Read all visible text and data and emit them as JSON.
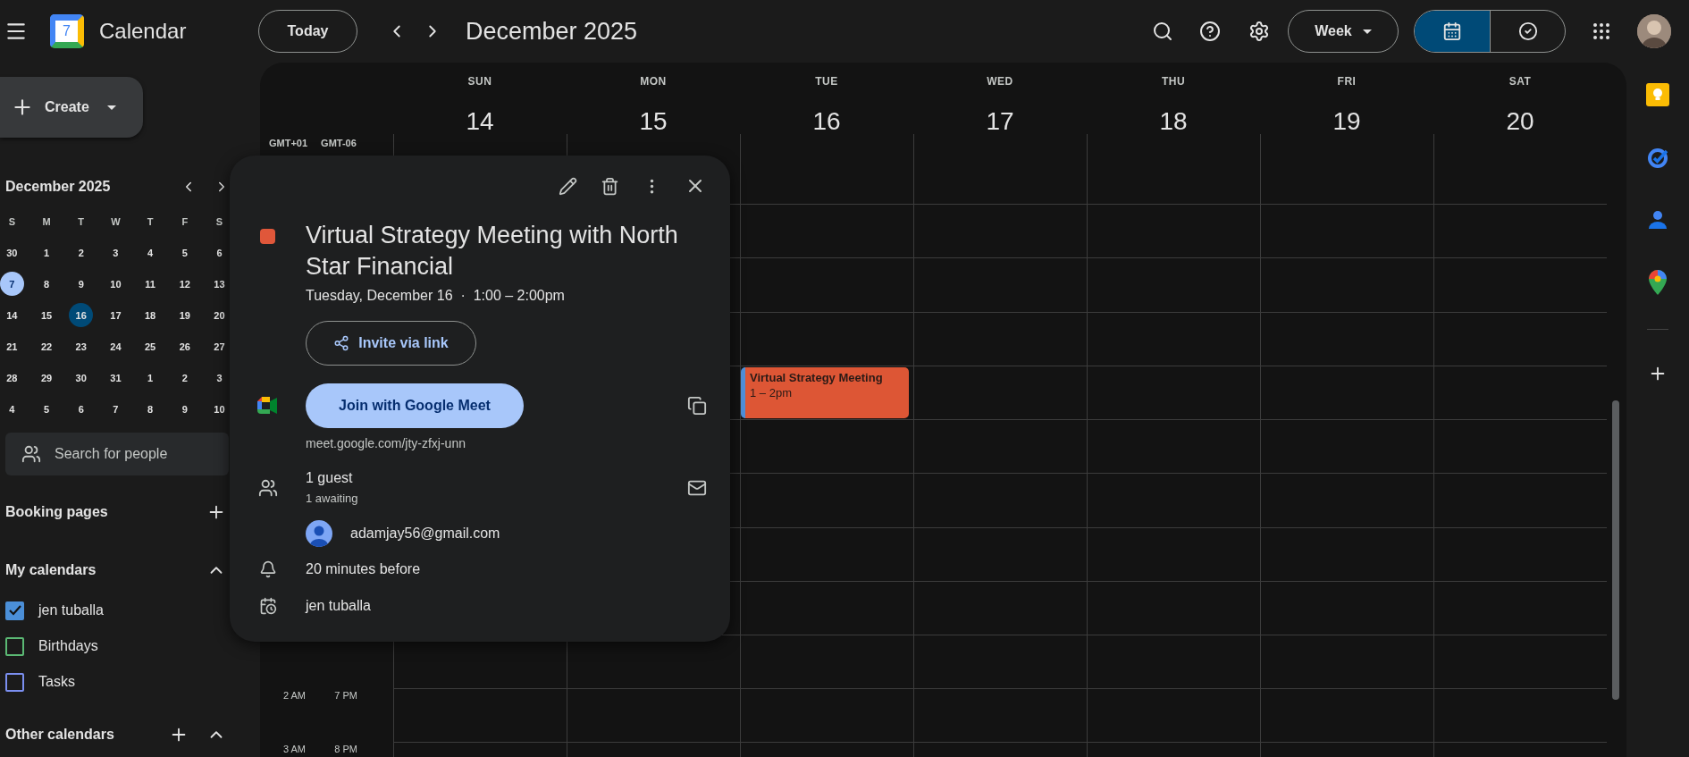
{
  "header": {
    "app_title": "Calendar",
    "logo_day": "7",
    "today_button": "Today",
    "period": "December 2025",
    "view_button": "Week",
    "mode_toggle": [
      {
        "kind": "calendar",
        "selected": true
      },
      {
        "kind": "tasks",
        "selected": false
      }
    ]
  },
  "sidebar": {
    "create_button": "Create",
    "mini_calendar": {
      "title": "December 2025",
      "weekdays": [
        "S",
        "M",
        "T",
        "W",
        "T",
        "F",
        "S"
      ],
      "weeks": [
        [
          {
            "day": "30",
            "today": false,
            "selected": false
          },
          {
            "day": "1",
            "today": false,
            "selected": false
          },
          {
            "day": "2",
            "today": false,
            "selected": false
          },
          {
            "day": "3",
            "today": false,
            "selected": false
          },
          {
            "day": "4",
            "today": false,
            "selected": false
          },
          {
            "day": "5",
            "today": false,
            "selected": false
          },
          {
            "day": "6",
            "today": false,
            "selected": false
          }
        ],
        [
          {
            "day": "7",
            "today": true,
            "selected": false
          },
          {
            "day": "8",
            "today": false,
            "selected": false
          },
          {
            "day": "9",
            "today": false,
            "selected": false
          },
          {
            "day": "10",
            "today": false,
            "selected": false
          },
          {
            "day": "11",
            "today": false,
            "selected": false
          },
          {
            "day": "12",
            "today": false,
            "selected": false
          },
          {
            "day": "13",
            "today": false,
            "selected": false
          }
        ],
        [
          {
            "day": "14",
            "today": false,
            "selected": false
          },
          {
            "day": "15",
            "today": false,
            "selected": false
          },
          {
            "day": "16",
            "today": false,
            "selected": true
          },
          {
            "day": "17",
            "today": false,
            "selected": false
          },
          {
            "day": "18",
            "today": false,
            "selected": false
          },
          {
            "day": "19",
            "today": false,
            "selected": false
          },
          {
            "day": "20",
            "today": false,
            "selected": false
          }
        ],
        [
          {
            "day": "21",
            "today": false,
            "selected": false
          },
          {
            "day": "22",
            "today": false,
            "selected": false
          },
          {
            "day": "23",
            "today": false,
            "selected": false
          },
          {
            "day": "24",
            "today": false,
            "selected": false
          },
          {
            "day": "25",
            "today": false,
            "selected": false
          },
          {
            "day": "26",
            "today": false,
            "selected": false
          },
          {
            "day": "27",
            "today": false,
            "selected": false
          }
        ],
        [
          {
            "day": "28",
            "today": false,
            "selected": false
          },
          {
            "day": "29",
            "today": false,
            "selected": false
          },
          {
            "day": "30",
            "today": false,
            "selected": false
          },
          {
            "day": "31",
            "today": false,
            "selected": false
          },
          {
            "day": "1",
            "today": false,
            "selected": false
          },
          {
            "day": "2",
            "today": false,
            "selected": false
          },
          {
            "day": "3",
            "today": false,
            "selected": false
          }
        ],
        [
          {
            "day": "4",
            "today": false,
            "selected": false
          },
          {
            "day": "5",
            "today": false,
            "selected": false
          },
          {
            "day": "6",
            "today": false,
            "selected": false
          },
          {
            "day": "7",
            "today": false,
            "selected": false
          },
          {
            "day": "8",
            "today": false,
            "selected": false
          },
          {
            "day": "9",
            "today": false,
            "selected": false
          },
          {
            "day": "10",
            "today": false,
            "selected": false
          }
        ]
      ]
    },
    "search_people": {
      "placeholder": "Search for people"
    },
    "booking_pages": "Booking pages",
    "my_calendars": {
      "title": "My calendars",
      "expanded": true,
      "items": [
        {
          "label": "jen tuballa",
          "checked": true,
          "color": "#4b8fd8"
        },
        {
          "label": "Birthdays",
          "checked": false,
          "color": "#5bb974"
        },
        {
          "label": "Tasks",
          "checked": false,
          "color": "#7b8ff0"
        }
      ]
    },
    "other_calendars": {
      "title": "Other calendars",
      "expanded": true
    }
  },
  "week": {
    "timezones": [
      "GMT+01",
      "GMT-06"
    ],
    "days": [
      {
        "name": "SUN",
        "date": "14"
      },
      {
        "name": "MON",
        "date": "15"
      },
      {
        "name": "TUE",
        "date": "16",
        "events": [
          {
            "title": "Virtual Strategy Meeting",
            "time": "1 – 2pm",
            "color": "#dd5635"
          }
        ]
      },
      {
        "name": "WED",
        "date": "17"
      },
      {
        "name": "THU",
        "date": "18"
      },
      {
        "name": "FRI",
        "date": "19"
      },
      {
        "name": "SAT",
        "date": "20"
      }
    ],
    "hours": [
      {
        "primary": "2 AM",
        "secondary": "7 PM"
      },
      {
        "primary": "3 AM",
        "secondary": "8 PM"
      }
    ]
  },
  "event_popup": {
    "color": "#e0573a",
    "title": "Virtual Strategy Meeting with North Star Financial",
    "when": "Tuesday, December 16  ·  1:00 – 2:00pm",
    "invite_button": "Invite via link",
    "join_button": "Join with Google Meet",
    "meet_link": "meet.google.com/jty-zfxj-unn",
    "guests": {
      "count": "1 guest",
      "status": "1 awaiting",
      "list": [
        {
          "email": "adamjay56@gmail.com"
        }
      ]
    },
    "reminder": "20 minutes before",
    "calendar": "jen tuballa"
  }
}
